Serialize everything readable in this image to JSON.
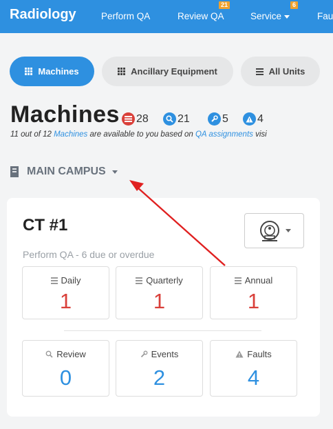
{
  "nav": {
    "brand": "Radiology",
    "items": [
      {
        "label": "Perform QA"
      },
      {
        "label": "Review QA",
        "badge": "21"
      },
      {
        "label": "Service",
        "badge": "6"
      },
      {
        "label": "Fau"
      }
    ]
  },
  "pills": [
    {
      "label": "Machines",
      "icon": "grid-icon",
      "active": true
    },
    {
      "label": "Ancillary Equipment",
      "icon": "grid-icon",
      "active": false
    },
    {
      "label": "All Units",
      "icon": "list-icon",
      "active": false
    }
  ],
  "heading": {
    "title": "Machines",
    "stats": [
      {
        "icon": "list-icon",
        "value": "28",
        "color": "#d9403a"
      },
      {
        "icon": "search-icon",
        "value": "21",
        "color": "#2e90e0"
      },
      {
        "icon": "wrench-icon",
        "value": "5",
        "color": "#2e90e0"
      },
      {
        "icon": "warning-icon",
        "value": "4",
        "color": "#2e90e0"
      }
    ],
    "subline": {
      "part1": "11 out of 12 ",
      "link1": "Machines",
      "part2": " are available to you based on ",
      "link2": "QA assignments",
      "part3": " visi"
    }
  },
  "campus": {
    "label": "MAIN CAMPUS",
    "icon": "building-icon"
  },
  "card": {
    "name": "CT #1",
    "machine_icon": "ct-scanner-icon",
    "qa_due": "Perform QA - 6 due or overdue",
    "qa_tiles": [
      {
        "label": "Daily",
        "value": "1"
      },
      {
        "label": "Quarterly",
        "value": "1"
      },
      {
        "label": "Annual",
        "value": "1"
      }
    ],
    "status_tiles": [
      {
        "label": "Review",
        "value": "0",
        "icon": "search-icon"
      },
      {
        "label": "Events",
        "value": "2",
        "icon": "wrench-icon"
      },
      {
        "label": "Faults",
        "value": "4",
        "icon": "warning-icon"
      }
    ]
  },
  "colors": {
    "accent": "#2e90e0",
    "danger": "#d9403a",
    "badge": "#f0a22e",
    "annotation_arrow": "#e02020"
  }
}
